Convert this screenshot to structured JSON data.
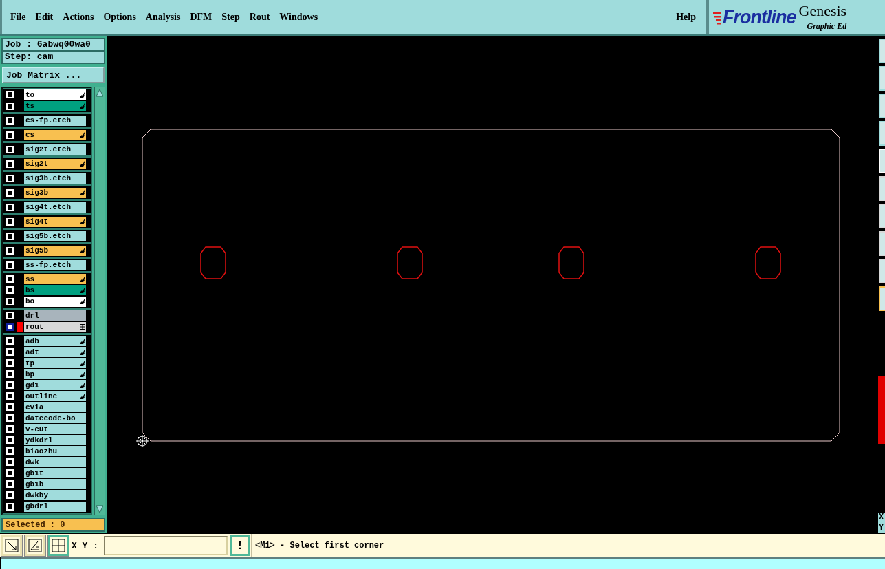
{
  "menu": [
    {
      "label": "File",
      "underlined": true
    },
    {
      "label": "Edit",
      "underlined": true
    },
    {
      "label": "Actions",
      "underlined": true
    },
    {
      "label": "Options",
      "underlined": false
    },
    {
      "label": "Analysis",
      "underlined": false
    },
    {
      "label": "DFM",
      "underlined": false
    },
    {
      "label": "Step",
      "underlined": true
    },
    {
      "label": "Rout",
      "underlined": true
    },
    {
      "label": "Windows",
      "underlined": true
    }
  ],
  "help": "Help",
  "logo": {
    "brand": "Frontline",
    "product": "Genesis",
    "subtitle": "Graphic Ed"
  },
  "job": "Job : 6abwq00wa0",
  "step": "Step: cam",
  "job_matrix_button": "Job Matrix ...",
  "layer_groups": [
    [
      {
        "name": "to",
        "color": "#ffffff",
        "affected": true,
        "kind": "layer",
        "displayed": false
      },
      {
        "name": "ts",
        "color": "#00a080",
        "affected": true,
        "kind": "layer",
        "displayed": false
      }
    ],
    [
      {
        "name": "cs-fp.etch",
        "color": "#a0dcdc",
        "affected": false,
        "kind": "layer",
        "displayed": false
      }
    ],
    [
      {
        "name": "cs",
        "color": "#f8c050",
        "affected": true,
        "kind": "layer",
        "displayed": false
      }
    ],
    [
      {
        "name": "sig2t.etch",
        "color": "#a0dcdc",
        "affected": false,
        "kind": "layer",
        "displayed": false
      }
    ],
    [
      {
        "name": "sig2t",
        "color": "#f8c050",
        "affected": true,
        "kind": "layer",
        "displayed": false
      }
    ],
    [
      {
        "name": "sig3b.etch",
        "color": "#a0dcdc",
        "affected": false,
        "kind": "layer",
        "displayed": false
      }
    ],
    [
      {
        "name": "sig3b",
        "color": "#f8c050",
        "affected": true,
        "kind": "layer",
        "displayed": false
      }
    ],
    [
      {
        "name": "sig4t.etch",
        "color": "#a0dcdc",
        "affected": false,
        "kind": "layer",
        "displayed": false
      }
    ],
    [
      {
        "name": "sig4t",
        "color": "#f8c050",
        "affected": true,
        "kind": "layer",
        "displayed": false
      }
    ],
    [
      {
        "name": "sig5b.etch",
        "color": "#a0dcdc",
        "affected": false,
        "kind": "layer",
        "displayed": false
      }
    ],
    [
      {
        "name": "sig5b",
        "color": "#f8c050",
        "affected": true,
        "kind": "layer",
        "displayed": false
      }
    ],
    [
      {
        "name": "ss-fp.etch",
        "color": "#a0dcdc",
        "affected": false,
        "kind": "layer",
        "displayed": false
      }
    ],
    [
      {
        "name": "ss",
        "color": "#f8c050",
        "affected": true,
        "kind": "layer",
        "displayed": false
      },
      {
        "name": "bs",
        "color": "#00a080",
        "affected": true,
        "kind": "layer",
        "displayed": false
      },
      {
        "name": "bo",
        "color": "#ffffff",
        "affected": true,
        "kind": "layer",
        "displayed": false
      }
    ],
    [
      {
        "name": "drl",
        "color": "#a8b4bc",
        "affected": false,
        "kind": "layer",
        "displayed": false
      },
      {
        "name": "rout",
        "color": "#d8d8d8",
        "kind": "rout",
        "displayed": true
      }
    ],
    [
      {
        "name": "adb",
        "color": "#a0dcdc",
        "affected": true,
        "kind": "layer",
        "displayed": false
      },
      {
        "name": "adt",
        "color": "#a0dcdc",
        "affected": true,
        "kind": "layer",
        "displayed": false
      },
      {
        "name": "tp",
        "color": "#a0dcdc",
        "affected": true,
        "kind": "layer",
        "displayed": false
      },
      {
        "name": "bp",
        "color": "#a0dcdc",
        "affected": true,
        "kind": "layer",
        "displayed": false
      },
      {
        "name": "gd1",
        "color": "#a0dcdc",
        "affected": true,
        "kind": "layer",
        "displayed": false
      },
      {
        "name": "outline",
        "color": "#a0dcdc",
        "affected": true,
        "kind": "layer",
        "displayed": false
      },
      {
        "name": "cvia",
        "color": "#a0dcdc",
        "affected": false,
        "kind": "layer",
        "displayed": false
      },
      {
        "name": "datecode-bo",
        "color": "#a0dcdc",
        "affected": false,
        "kind": "layer",
        "displayed": false
      },
      {
        "name": "v-cut",
        "color": "#a0dcdc",
        "affected": false,
        "kind": "layer",
        "displayed": false
      },
      {
        "name": "ydkdrl",
        "color": "#a0dcdc",
        "affected": false,
        "kind": "layer",
        "displayed": false
      },
      {
        "name": "biaozhu",
        "color": "#a0dcdc",
        "affected": false,
        "kind": "layer",
        "displayed": false
      },
      {
        "name": "dwk",
        "color": "#a0dcdc",
        "affected": false,
        "kind": "layer",
        "displayed": false
      },
      {
        "name": "gb1t",
        "color": "#a0dcdc",
        "affected": false,
        "kind": "layer",
        "displayed": false
      },
      {
        "name": "gb1b",
        "color": "#a0dcdc",
        "affected": false,
        "kind": "layer",
        "displayed": false
      },
      {
        "name": "dwkby",
        "color": "#a0dcdc",
        "affected": false,
        "kind": "layer",
        "displayed": false
      },
      {
        "name": "gbdrl",
        "color": "#a0dcdc",
        "affected": false,
        "kind": "layer",
        "displayed": false
      }
    ]
  ],
  "selected_count": "Selected : 0",
  "tools": [
    {
      "kind": "zoom",
      "selected": false
    },
    {
      "kind": "angle",
      "selected": false
    },
    {
      "kind": "grid",
      "selected": true
    }
  ],
  "xy_label": "X Y :",
  "confirm_button": "!",
  "message": "<M1> - Select first corner",
  "right_strip": {
    "x_label": "X",
    "y_label": "Y"
  }
}
